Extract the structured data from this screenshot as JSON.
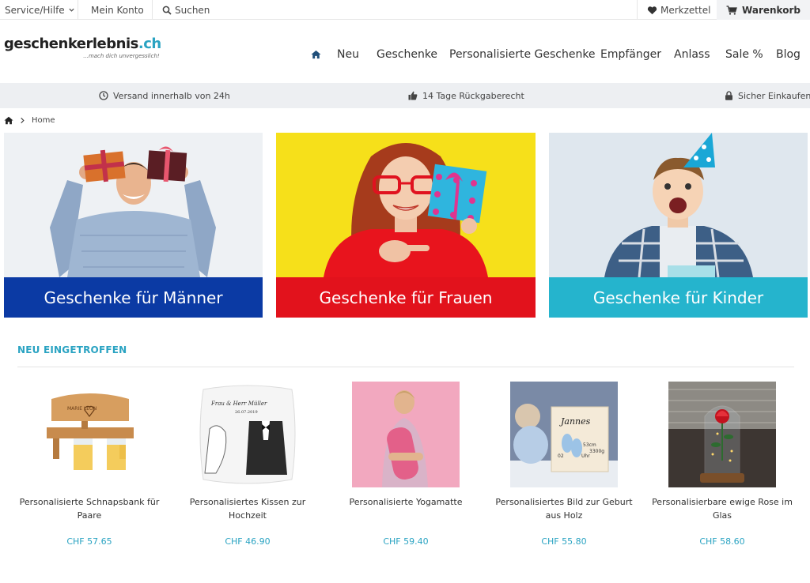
{
  "topbar": {
    "service_label": "Service/Hilfe",
    "account_label": "Mein Konto",
    "search_label": "Suchen",
    "wishlist_label": "Merkzettel",
    "cart_label": "Warenkorb"
  },
  "logo": {
    "name": "geschenkerlebnis",
    "tld": ".ch",
    "tagline": "...mach dich unvergesslich!"
  },
  "nav": {
    "items": [
      "Neu",
      "Geschenke",
      "Personalisierte Geschenke",
      "Empfänger",
      "Anlass",
      "Sale %",
      "Blog"
    ]
  },
  "benefits": {
    "shipping": "Versand innerhalb von 24h",
    "returns": "14 Tage Rückgaberecht",
    "secure": "Sicher Einkaufen"
  },
  "breadcrumb": {
    "home_label": "Home"
  },
  "categories": [
    {
      "label": "Geschenke für Männer",
      "bar_color": "#0b3aa4"
    },
    {
      "label": "Geschenke für Frauen",
      "bar_color": "#e2121c"
    },
    {
      "label": "Geschenke für Kinder",
      "bar_color": "#25b4cd"
    }
  ],
  "new_products": {
    "title": "NEU EINGETROFFEN",
    "items": [
      {
        "name": "Personalisierte Schnapsbank für Paare",
        "price": "CHF 57.65"
      },
      {
        "name": "Personalisiertes Kissen zur Hochzeit",
        "price": "CHF 46.90"
      },
      {
        "name": "Personalisierte Yogamatte",
        "price": "CHF 59.40"
      },
      {
        "name": "Personalisiertes Bild zur Geburt aus Holz",
        "price": "CHF 55.80"
      },
      {
        "name": "Personalisierbare ewige Rose im Glas",
        "price": "CHF 58.60"
      }
    ]
  },
  "image_text": {
    "bench_names": "MARIE  LEON",
    "pillow_names": "Frau & Herr Müller",
    "pillow_date": "26.07.2019",
    "birth_name": "Jannes",
    "birth_date": "02",
    "birth_size": "53cm",
    "birth_time": "Uhr",
    "birth_weight": "3300g"
  },
  "colors": {
    "accent": "#2aa3c2",
    "benefits_bg": "#edeff2",
    "men_banner_bg": "#eef1f4",
    "women_banner_bg": "#f6e01a",
    "kids_banner_bg": "#dfe7ee"
  },
  "icons": {
    "service_chevron": "chevron-down-icon",
    "search": "search-icon",
    "wishlist": "heart-icon",
    "cart": "cart-icon",
    "home": "home-icon",
    "shipping": "clock-icon",
    "returns": "thumbs-up-icon",
    "secure": "lock-icon",
    "breadcrumb_separator": "chevron-right-icon"
  }
}
